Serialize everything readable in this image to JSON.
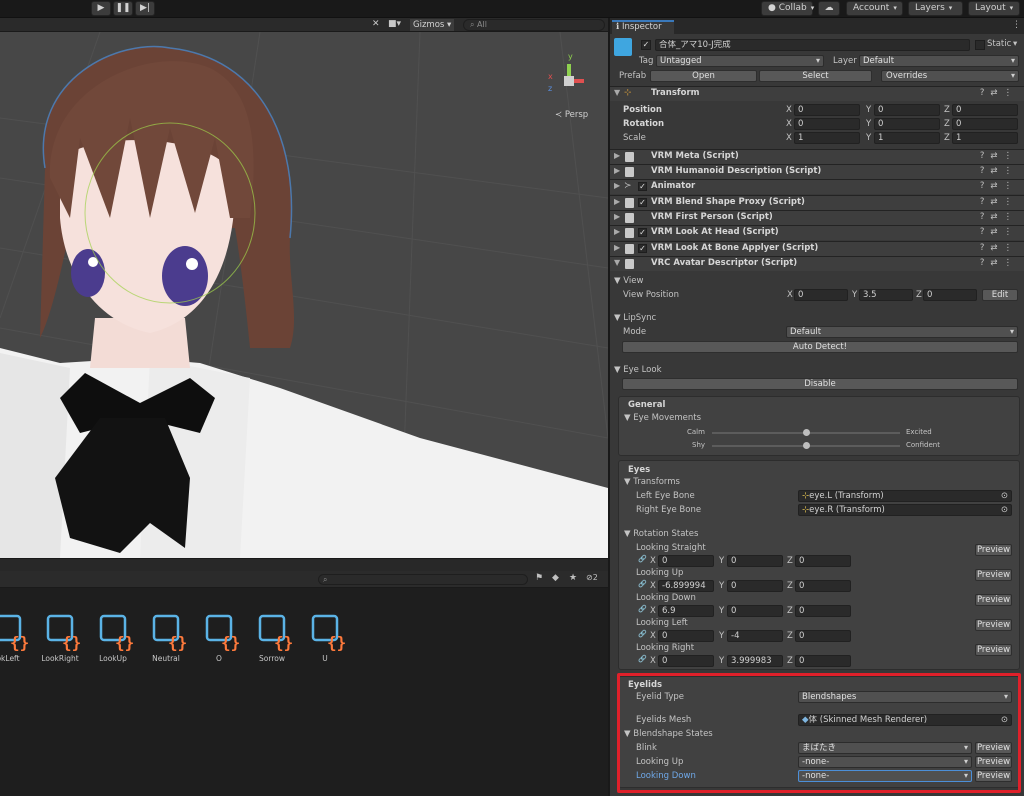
{
  "toolbar": {
    "collab": "Collab",
    "account": "Account",
    "layers": "Layers",
    "layout": "Layout",
    "colors": {
      "bg": "#191919",
      "button": "#3c3c3c"
    }
  },
  "scene": {
    "gizmos": "Gizmos",
    "search_placeholder": "All",
    "persp": "Persp",
    "axes": {
      "x": "x",
      "y": "y",
      "z": "z"
    }
  },
  "project": {
    "hidden_count": "2",
    "assets": [
      "okLeft",
      "LookRight",
      "LookUp",
      "Neutral",
      "O",
      "Sorrow",
      "U"
    ]
  },
  "inspector": {
    "tab": "Inspector",
    "object_name": "合体_アマ10-J完成",
    "static": "Static",
    "tag_label": "Tag",
    "tag_value": "Untagged",
    "layer_label": "Layer",
    "layer_value": "Default",
    "prefab_label": "Prefab",
    "open": "Open",
    "select": "Select",
    "overrides": "Overrides",
    "transform": {
      "title": "Transform",
      "position_label": "Position",
      "rotation_label": "Rotation",
      "scale_label": "Scale",
      "position": [
        "0",
        "0",
        "0"
      ],
      "rotation": [
        "0",
        "0",
        "0"
      ],
      "scale": [
        "1",
        "1",
        "1"
      ]
    },
    "components": [
      {
        "name": "VRM Meta (Script)",
        "checkbox": false
      },
      {
        "name": "VRM Humanoid Description (Script)",
        "checkbox": false
      },
      {
        "name": "Animator",
        "checkbox": true
      },
      {
        "name": "VRM Blend Shape Proxy (Script)",
        "checkbox": true
      },
      {
        "name": "VRM First Person (Script)",
        "checkbox": false
      },
      {
        "name": "VRM Look At Head (Script)",
        "checkbox": true
      },
      {
        "name": "VRM Look At Bone Applyer (Script)",
        "checkbox": true
      },
      {
        "name": "VRC Avatar Descriptor (Script)",
        "checkbox": false
      }
    ],
    "view": {
      "title": "View",
      "position_label": "View Position",
      "x": "0",
      "y": "3.5",
      "z": "0",
      "edit": "Edit"
    },
    "lipsync": {
      "title": "LipSync",
      "mode_label": "Mode",
      "mode_value": "Default",
      "auto_detect": "Auto Detect!"
    },
    "eyelook": {
      "title": "Eye Look",
      "disable": "Disable",
      "general": "General",
      "eye_movements": "Eye Movements",
      "calm": "Calm",
      "excited": "Excited",
      "shy": "Shy",
      "confident": "Confident",
      "calm_excited_level": 0.5,
      "shy_confident_level": 0.5,
      "eyes": "Eyes",
      "transforms": "Transforms",
      "left_eye_label": "Left Eye Bone",
      "left_eye_value": "eye.L (Transform)",
      "right_eye_label": "Right Eye Bone",
      "right_eye_value": "eye.R (Transform)",
      "rotation_states": "Rotation States",
      "preview": "Preview",
      "states": [
        {
          "name": "Looking Straight",
          "x": "0",
          "y": "0",
          "z": "0"
        },
        {
          "name": "Looking Up",
          "x": "-6.899994",
          "y": "0",
          "z": "0"
        },
        {
          "name": "Looking Down",
          "x": "6.9",
          "y": "0",
          "z": "0"
        },
        {
          "name": "Looking Left",
          "x": "0",
          "y": "-4",
          "z": "0"
        },
        {
          "name": "Looking Right",
          "x": "0",
          "y": "3.999983",
          "z": "0"
        }
      ]
    },
    "eyelids": {
      "title": "Eyelids",
      "type_label": "Eyelid Type",
      "type_value": "Blendshapes",
      "mesh_label": "Eyelids Mesh",
      "mesh_value": "体 (Skinned Mesh Renderer)",
      "blendshape_states": "Blendshape States",
      "blink_label": "Blink",
      "blink_value": "まばたき",
      "up_label": "Looking Up",
      "up_value": "-none-",
      "down_label": "Looking Down",
      "down_value": "-none-",
      "highlight_color": "#e0202a"
    }
  }
}
